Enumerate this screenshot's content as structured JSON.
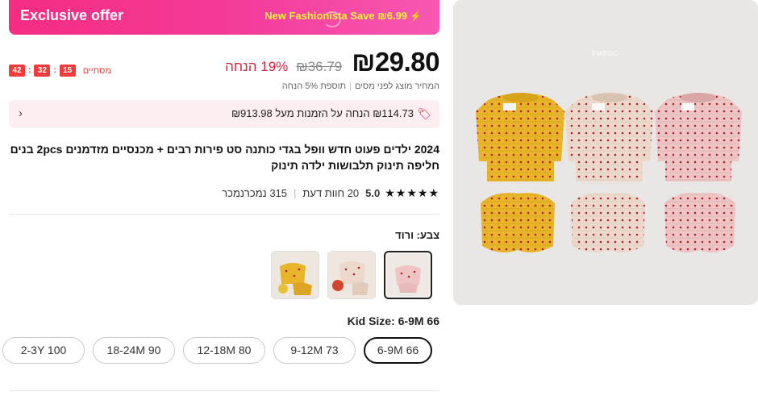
{
  "offer": {
    "title": "Exclusive offer",
    "save_text": "New Fashionista Save ₪6.99",
    "accent_color": "#f52c83",
    "save_color": "#fff23c",
    "icon": "lightning-icon"
  },
  "price": {
    "current": "₪29.80",
    "original": "₪36.79",
    "discount": "19% הנחה",
    "note_left": "המחיר מוצג לפני מסים",
    "note_right": "תוספת 5% הנחה"
  },
  "countdown": {
    "label": "מסתיים",
    "hours": "15",
    "minutes": "32",
    "seconds": "42",
    "color": "#f23c3c"
  },
  "coupon": {
    "text": "₪114.73 הנחה על הזמנות מעל ₪913.98",
    "icon": "tag-icon"
  },
  "product": {
    "title": "2024 ילדים פעוט חדש וופל בגדי כותנה סט פירות רבים + מכנסיים מזדמנים 2pcs בנים חליפה תינוק תלבושות ילדה תינוק",
    "rating": "5.0",
    "reviews": "20 חוות דעת",
    "sold": "315 נמכרנמכר",
    "brand_mark": "FMPDC"
  },
  "color": {
    "label": "צבע: ורוד",
    "options": [
      "ורוד",
      "בז'",
      "צהוב"
    ],
    "selected_index": 0
  },
  "size": {
    "label": "Kid Size: 6-9M 66",
    "options": [
      "6-9M 66",
      "9-12M 73",
      "12-18M 80",
      "18-24M 90",
      "2-3Y 100"
    ],
    "selected_index": 0
  }
}
